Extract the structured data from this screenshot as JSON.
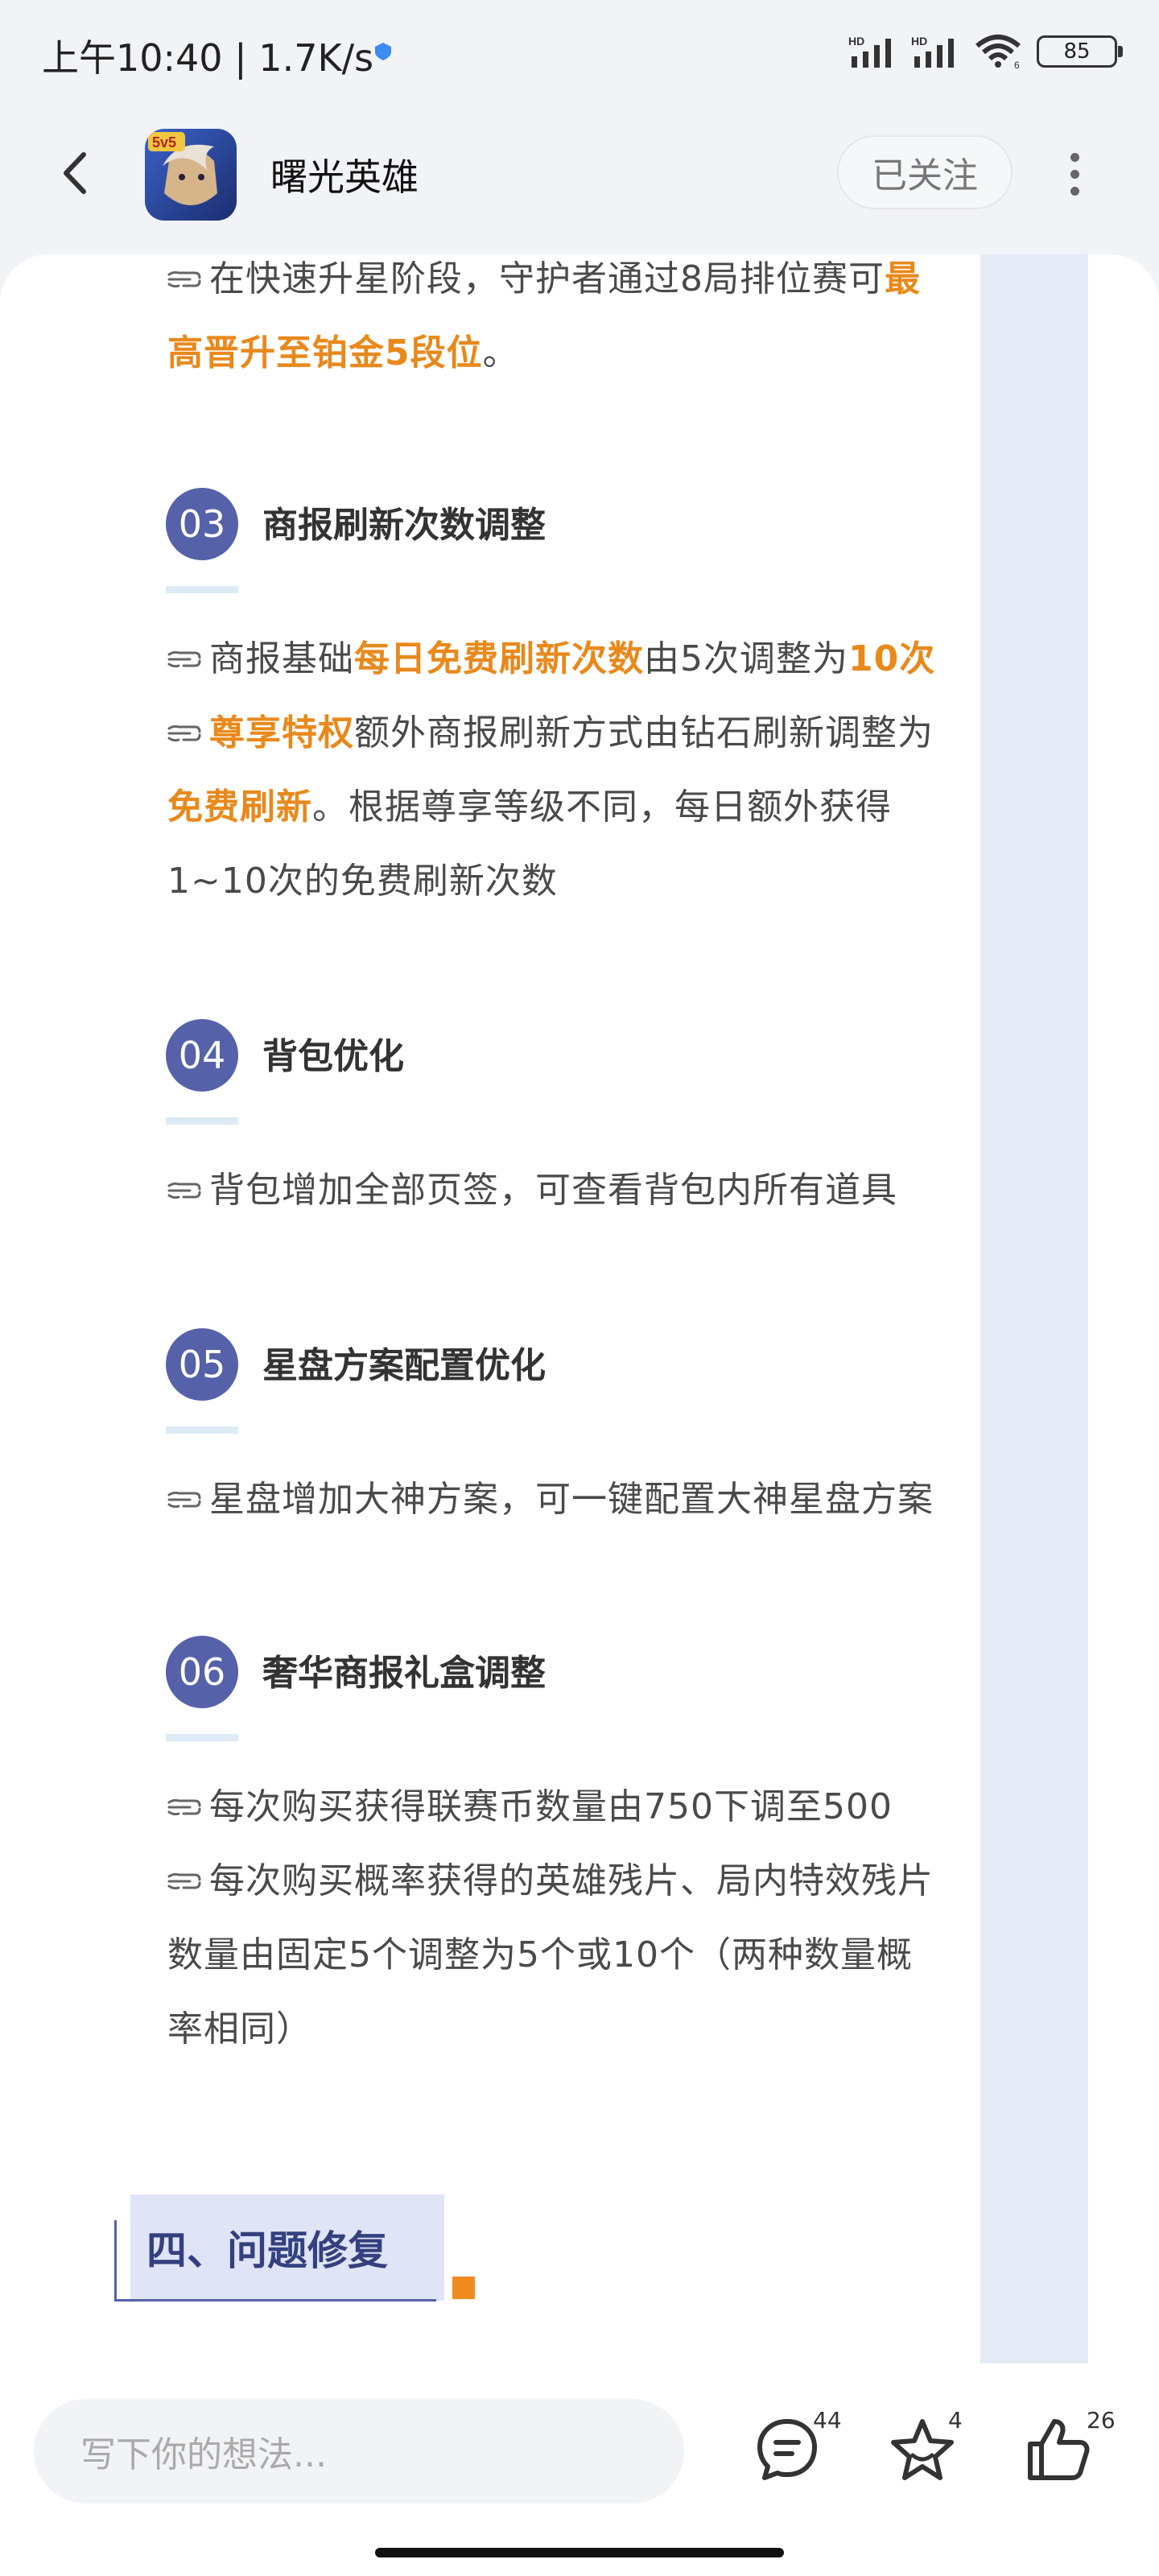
{
  "status_bar": {
    "time": "上午10:40 | 1.7K/s",
    "network_1": "HD",
    "network_2": "HD",
    "wifi_badge": "6",
    "battery": "85"
  },
  "header": {
    "app_name": "曙光英雄",
    "app_icon_text": "5v5",
    "follow_label": "已关注"
  },
  "content": {
    "intro_line_1_pre": "在快速升星阶段，守护者通过8局排位赛可",
    "intro_line_1_hl": "最",
    "intro_line_2_hl": "高晋升至铂金5段位",
    "intro_line_2_post": "。",
    "sections": [
      {
        "number": "03",
        "title": "商报刷新次数调整",
        "l1_pre": "商报基础",
        "l1_hl": "每日免费刷新次数",
        "l1_mid": "由5次调整为",
        "l1_hl2": "10次",
        "l2_hl": "尊享特权",
        "l2_post": "额外商报刷新方式由钻石刷新调整为",
        "l3_hl": "免费刷新",
        "l3_post": "。根据尊享等级不同，每日额外获得",
        "l4": "1~10次的免费刷新次数"
      },
      {
        "number": "04",
        "title": "背包优化",
        "l1": "背包增加全部页签，可查看背包内所有道具"
      },
      {
        "number": "05",
        "title": "星盘方案配置优化",
        "l1": "星盘增加大神方案，可一键配置大神星盘方案"
      },
      {
        "number": "06",
        "title": "奢华商报礼盒调整",
        "l1": "每次购买获得联赛币数量由750下调至500",
        "l2": "每次购买概率获得的英雄残片、局内特效残片",
        "l3": "数量由固定5个调整为5个或10个（两种数量概",
        "l4": "率相同）"
      }
    ],
    "section_four_title": "四、问题修复"
  },
  "bottom_bar": {
    "comment_placeholder": "写下你的想法...",
    "comment_count": "44",
    "favorite_count": "4",
    "like_count": "26"
  },
  "colors": {
    "accent_orange": "#e8891c",
    "section_blue": "#5561a8",
    "poster_border": "#e6eaf6"
  },
  "icons": [
    "back-arrow-icon",
    "app-icon",
    "more-icon",
    "hand-pointer-icon",
    "comment-icon",
    "star-icon",
    "thumbs-up-icon"
  ]
}
